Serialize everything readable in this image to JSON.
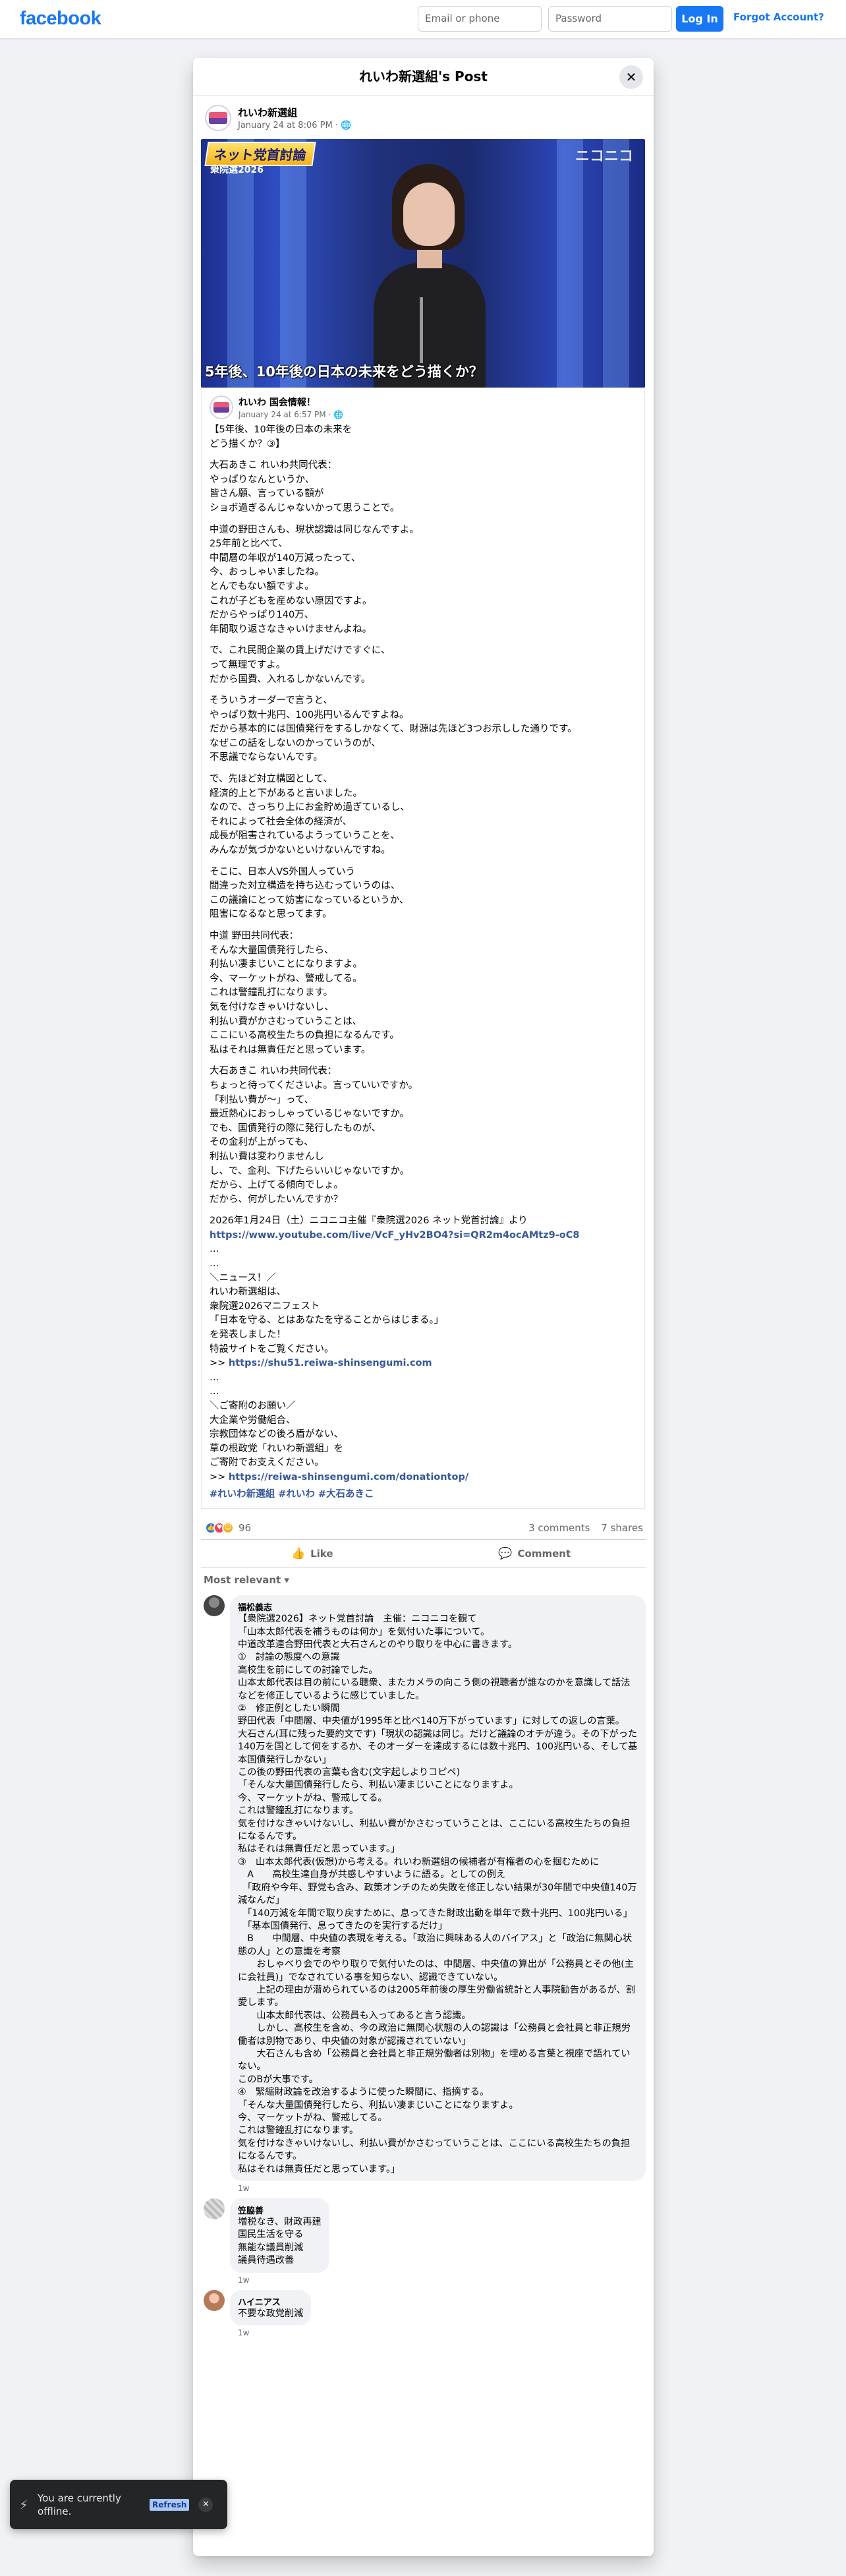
{
  "topbar": {
    "logo": "facebook",
    "email_placeholder": "Email or phone",
    "password_placeholder": "Password",
    "login_label": "Log In",
    "forgot_label": "Forgot Account?"
  },
  "modal": {
    "title": "れいわ新選組's Post",
    "close_icon": "close-icon"
  },
  "post": {
    "author": "れいわ新選組",
    "timestamp": "January 24 at 8:06 PM · ",
    "video": {
      "banner": "ネット党首討論",
      "banner_sub": "衆院選2026",
      "channel": "ニコニコ",
      "caption": "5年後、10年後の日本の未来をどう描くか？"
    },
    "shared": {
      "author": "れいわ 国会情報！",
      "timestamp": "January 24 at 6:57 PM · "
    },
    "paragraphs": [
      "【5年後、10年後の日本の未来を\nどう描くか？③】",
      "大石あきこ れいわ共同代表：\nやっぱりなんというか、\n皆さん願、言っている額が\nショボ過ぎるんじゃないかって思うことで。",
      "中道の野田さんも、現状認識は同じなんですよ。\n25年前と比べて、\n中間層の年収が140万減ったって、\n今、おっしゃいましたね。\nとんでもない額ですよ。\nこれが子どもを産めない原因ですよ。\nだからやっぱり140万、\n年間取り返さなきゃいけませんよね。",
      "で、これ民間企業の賃上げだけですぐに、\nって無理ですよ。\nだから国費、入れるしかないんです。",
      "そういうオーダーで言うと、\nやっぱり数十兆円、100兆円いるんですよね。\nだから基本的には国債発行をするしかなくて、財源は先ほど3つお示しした通りです。\nなぜこの話をしないのかっていうのが、\n不思議でならないんです。",
      "で、先ほど対立構図として、\n経済的上と下があると言いました。\nなので、さっちり上にお金貯め過ぎているし、\nそれによって社会全体の経済が、\n成長が阻害されているようっていうことを、\nみんなが気づかないといけないんですね。",
      "そこに、日本人VS外国人っていう\n間違った対立構造を持ち込むっていうのは、\nこの議論にとって妨害になっているというか、\n阻害になるなと思ってます。",
      "中道 野田共同代表：\nそんな大量国債発行したら、\n利払い凄まじいことになりますよ。\n今、マーケットがね、警戒してる。\nこれは警鐘乱打になります。\n気を付けなきゃいけないし、\n利払い費がかさむっていうことは、\nここにいる高校生たちの負担になるんです。\n私はそれは無責任だと思っています。",
      "大石あきこ れいわ共同代表：\nちょっと待ってくださいよ。言っていいですか。\n「利払い費が～」って、\n最近熱心におっしゃっているじゃないですか。\nでも、国債発行の際に発行したものが、\nその金利が上がっても、\n利払い費は変わりませんし\nし、で、金利、下げたらいいじゃないですか。\nだから、上げてる傾向でしょ。\nだから、何がしたいんですか？"
    ],
    "source_line": "2026年1月24日（土）ニコニコ主催『衆院選2026 ネット党首討論』より",
    "source_url": "https://www.youtube.com/live/VcF_yHv2BO4?si=QR2m4ocAMtz9-oC8",
    "dots": "…\n…",
    "news_block": "＼ニュース！／\nれいわ新選組は、\n衆院選2026マニフェスト\n「日本を守る、とはあなたを守ることからはじまる。」\nを発表しました！\n特設サイトをご覧ください。",
    "news_prefix": ">> ",
    "news_url": "https://shu51.reiwa-shinsengumi.com",
    "dots2": "…\n…",
    "donation_block": "＼ご寄附のお願い／\n大企業や労働組合、\n宗教団体などの後ろ盾がない、\n草の根政党「れいわ新選組」を\nご寄附でお支えください。",
    "donation_prefix": ">> ",
    "donation_url": "https://reiwa-shinsengumi.com/donationtop/",
    "hashtags": "#れいわ新選組 #れいわ #大石あきこ"
  },
  "reactions": {
    "count": "96",
    "comments": "3 comments",
    "shares": "7 shares",
    "like_label": "Like",
    "comment_label": "Comment",
    "sort_label": "Most relevant"
  },
  "comments": [
    {
      "name": "福松義志",
      "text": "【衆院選2026】ネット党首討論　主催：ニコニコを観て\n「山本太郎代表を補うものは何か」を気付いた事について。\n中道改革連合野田代表と大石さんとのやり取りを中心に書きます。\n①　討論の態度への意識\n高校生を前にしての討論でした。\n山本太郎代表は目の前にいる聴衆、またカメラの向こう側の視聴者が誰なのかを意識して話法などを修正しているように感じていました。\n②　修正例としたい瞬間\n野田代表「中間層、中央値が1995年と比べ140万下がっています」に対しての返しの言葉。\n大石さん(耳に残った要約文です)「現状の認識は同じ。だけど議論のオチが違う。その下がった140万を国として何をするか、そのオーダーを達成するには数十兆円、100兆円いる、そして基本国債発行しかない」\nこの後の野田代表の言葉も含む(文字起しよりコピペ)\n「そんな大量国債発行したら、利払い凄まじいことになりますよ。\n今、マーケットがね、警戒してる。\nこれは警鐘乱打になります。\n気を付けなきゃいけないし、利払い費がかさむっていうことは、ここにいる高校生たちの負担になるんです。\n私はそれは無責任だと思っています。」\n③　山本太郎代表(仮想)から考える。れいわ新選組の候補者が有権者の心を掴むために\n　A　　高校生達自身が共感しやすいように語る。としての例え\n　「政府や今年、野党も含み、政策オンチのため失敗を修正しない結果が30年間で中央値140万減なんだ」\n　「140万減を年間で取り戻すために、息ってきた財政出動を単年で数十兆円、100兆円いる」\n　「基本国債発行、息ってきたのを実行するだけ」\n　B　　中間層、中央値の表現を考える。「政治に興味ある人のバイアス」と「政治に無関心状態の人」との意識を考察\n　　おしゃべり会でのやり取りで気付いたのは、中間層、中央値の算出が「公務員とその他(主に会社員)」でなされている事を知らない、認識できていない。\n　　上記の理由が潜められているのは2005年前後の厚生労働省統計と人事院勧告があるが、割愛します。\n　　山本太郎代表は、公務員も入ってあると言う認識。\n　　しかし、高校生を含め、今の政治に無関心状態の人の認識は「公務員と会社員と非正規労働者は別物であり、中央値の対象が認識されていない」\n　　大石さんも含め「公務員と会社員と非正規労働者は別物」を埋める言葉と視座で語れていない。\nこのBが大事です。\n④　緊縮財政論を改治するように使った瞬間に、指摘する。\n「そんな大量国債発行したら、利払い凄まじいことになりますよ。\n今、マーケットがね、警戒してる。\nこれは警鐘乱打になります。\n気を付けなきゃいけないし、利払い費がかさむっていうことは、ここにいる高校生たちの負担になるんです。\n私はそれは無責任だと思っています。」",
      "time": "1w"
    },
    {
      "name": "笠脇善",
      "text": "増税なき、財政再建\n国民生活を守る\n無能な議員削減\n議員待遇改善",
      "time": "1w"
    },
    {
      "name": "ハイニアス",
      "text": "不要な政党削減",
      "time": "1w"
    }
  ],
  "toast": {
    "text": "You are currently offline.",
    "refresh": "Refresh"
  },
  "colors": {
    "brand": "#1877f2",
    "link": "#385898",
    "page_bg": "#f0f2f5"
  }
}
